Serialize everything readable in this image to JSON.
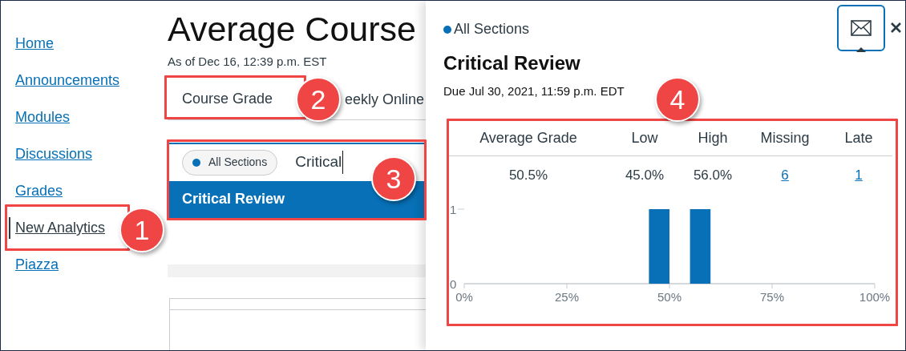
{
  "nav": {
    "items": [
      {
        "label": "Home",
        "selected": false
      },
      {
        "label": "Announcements",
        "selected": false
      },
      {
        "label": "Modules",
        "selected": false
      },
      {
        "label": "Discussions",
        "selected": false
      },
      {
        "label": "Grades",
        "selected": false
      },
      {
        "label": "New Analytics",
        "selected": true
      },
      {
        "label": "Piazza",
        "selected": false
      }
    ]
  },
  "page": {
    "title": "Average Course",
    "as_of": "As of Dec 16, 12:39 p.m. EST",
    "tabs": [
      {
        "label": "Course Grade",
        "selected": true
      },
      {
        "label": "eekly Online",
        "selected": false
      }
    ],
    "search": {
      "section_chip": "All Sections",
      "value": "Critical",
      "suggestions": [
        {
          "label": "Critical Review",
          "selected": true
        }
      ]
    }
  },
  "panel": {
    "section": "All Sections",
    "title": "Critical Review",
    "due": "Due Jul 30, 2021, 11:59 p.m. EDT",
    "stats": {
      "columns": [
        "Average Grade",
        "Low",
        "High",
        "Missing",
        "Late"
      ],
      "values": [
        {
          "text": "50.5%",
          "kind": "text"
        },
        {
          "text": "45.0%",
          "kind": "text"
        },
        {
          "text": "56.0%",
          "kind": "text"
        },
        {
          "text": "6",
          "kind": "link"
        },
        {
          "text": "1",
          "kind": "link"
        }
      ]
    },
    "chart_data": {
      "type": "bar",
      "x": [
        47.5,
        57.5
      ],
      "values": [
        1,
        1
      ],
      "xlim": [
        0,
        100
      ],
      "ylim": [
        0,
        1
      ],
      "xticks": [
        {
          "value": 0,
          "label": "0%"
        },
        {
          "value": 25,
          "label": "25%"
        },
        {
          "value": 50,
          "label": "50%"
        },
        {
          "value": 75,
          "label": "75%"
        },
        {
          "value": 100,
          "label": "100%"
        }
      ],
      "yticks": [
        0,
        1
      ]
    }
  },
  "callouts": [
    "1",
    "2",
    "3",
    "4"
  ]
}
